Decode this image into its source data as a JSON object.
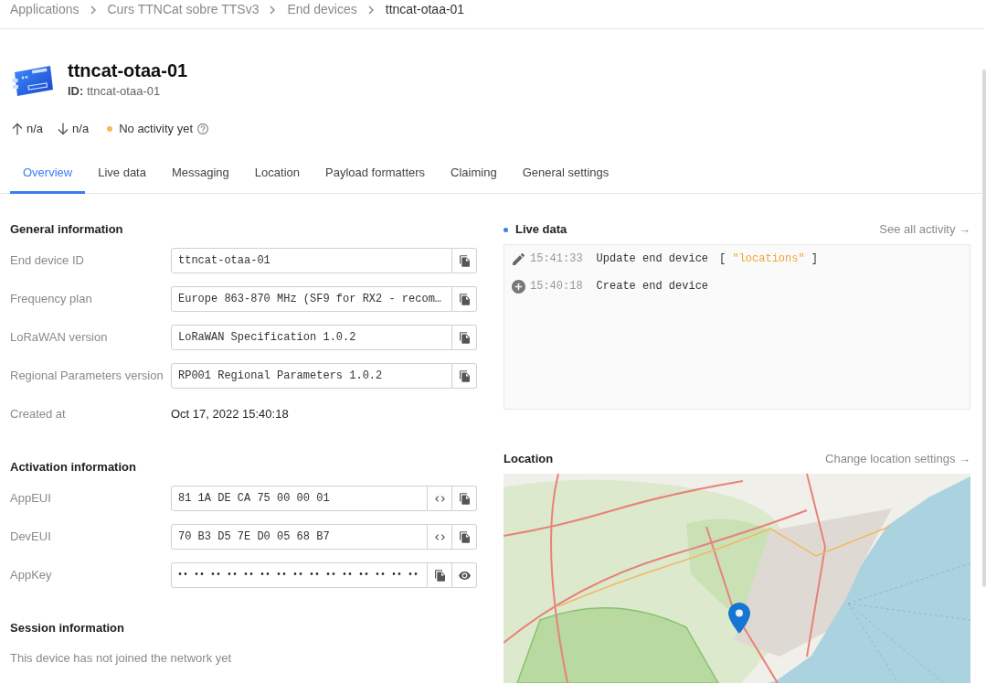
{
  "breadcrumbs": [
    {
      "label": "Applications",
      "current": false
    },
    {
      "label": "Curs TTNCat sobre TTSv3",
      "current": false
    },
    {
      "label": "End devices",
      "current": false
    },
    {
      "label": "ttncat-otaa-01",
      "current": true
    }
  ],
  "device": {
    "name": "ttncat-otaa-01",
    "id_line": "**ID:** ttncat-otaa-01",
    "uplink": "n/a",
    "downlink": "n/a",
    "activity": "No activity yet"
  },
  "tabs": [
    {
      "label": "Overview",
      "selected": true
    },
    {
      "label": "Live data",
      "selected": false
    },
    {
      "label": "Messaging",
      "selected": false
    },
    {
      "label": "Location",
      "selected": false
    },
    {
      "label": "Payload formatters",
      "selected": false
    },
    {
      "label": "Claiming",
      "selected": false
    },
    {
      "label": "General settings",
      "selected": false
    }
  ],
  "sections": [
    {
      "title": "General information",
      "rows": [
        {
          "kind": "copy",
          "label": "End device ID",
          "value": "ttncat-otaa-01"
        },
        {
          "kind": "copy",
          "label": "Frequency plan",
          "value": "Europe 863-870 MHz (SF9 for RX2 - recom…"
        },
        {
          "kind": "copy",
          "label": "LoRaWAN version",
          "value": "LoRaWAN Specification 1.0.2"
        },
        {
          "kind": "copy",
          "label": "Regional Parameters version",
          "value": "RP001 Regional Parameters 1.0.2"
        },
        {
          "kind": "text",
          "label": "Created at",
          "value": "Oct 17, 2022 15:40:18"
        }
      ]
    },
    {
      "title": "Activation information",
      "rows": [
        {
          "kind": "eui",
          "label": "AppEUI",
          "value": "81 1A DE CA 75 00 00 01"
        },
        {
          "kind": "eui",
          "label": "DevEUI",
          "value": "70 B3 D5 7E D0 05 68 B7"
        },
        {
          "kind": "secret",
          "label": "AppKey",
          "value": "•• •• •• •• •• •• •• •• •• •• •• •• •• •• ••"
        }
      ]
    },
    {
      "title": "Session information",
      "note": "This device has not joined the network yet"
    }
  ],
  "live_data": {
    "title": "Live data",
    "link": "See all activity →",
    "events": [
      {
        "kind": "update",
        "time": "15:41:33",
        "message": "Update end device",
        "detail": [
          {
            "kind": "bracket",
            "text": "["
          },
          {
            "kind": "string",
            "text": "\"locations\""
          },
          {
            "kind": "bracket",
            "text": "]"
          }
        ]
      },
      {
        "kind": "create",
        "time": "15:40:18",
        "message": "Create end device"
      }
    ]
  },
  "location": {
    "title": "Location",
    "link": "Change location settings →"
  }
}
